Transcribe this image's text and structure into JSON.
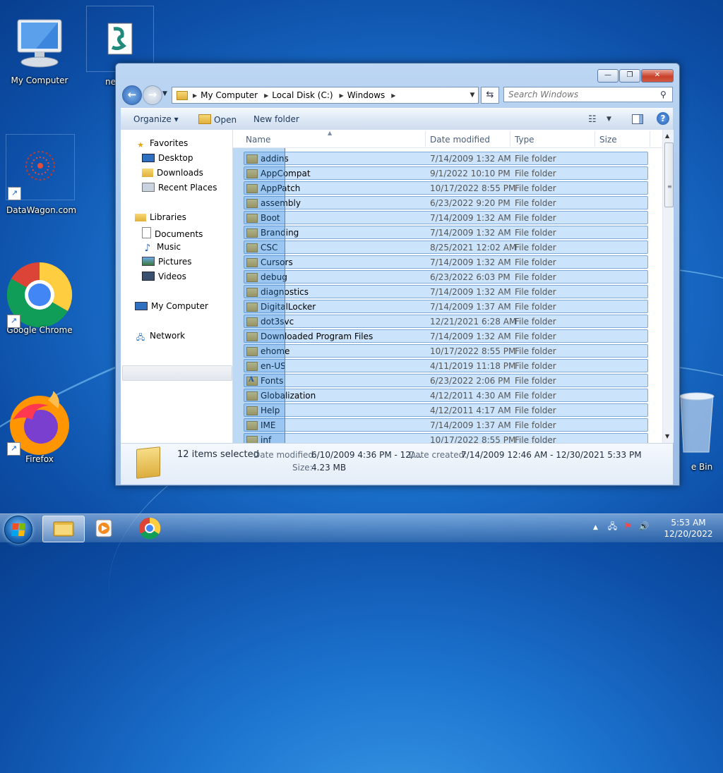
{
  "desktop": {
    "icons": [
      {
        "label": "My Computer"
      },
      {
        "label": "ne"
      },
      {
        "label": "DataWagon.com"
      },
      {
        "label": "Google Chrome"
      },
      {
        "label": "Firefox"
      },
      {
        "label": "e Bin"
      }
    ]
  },
  "window": {
    "caption_buttons": {
      "minimize": "—",
      "maximize": "❐",
      "close": "✕"
    },
    "address": {
      "segments": [
        "My Computer",
        "Local Disk (C:)",
        "Windows"
      ]
    },
    "search_placeholder": "Search Windows",
    "toolbar": {
      "organize": "Organize",
      "open": "Open",
      "new_folder": "New folder"
    },
    "nav": {
      "favorites": "Favorites",
      "desktop": "Desktop",
      "downloads": "Downloads",
      "recent_places": "Recent Places",
      "libraries": "Libraries",
      "documents": "Documents",
      "music": "Music",
      "pictures": "Pictures",
      "videos": "Videos",
      "my_computer": "My Computer",
      "network": "Network"
    },
    "columns": {
      "name": "Name",
      "date": "Date modified",
      "type": "Type",
      "size": "Size"
    },
    "files": [
      {
        "name": "addins",
        "date": "7/14/2009 1:32 AM",
        "type": "File folder"
      },
      {
        "name": "AppCompat",
        "date": "9/1/2022 10:10 PM",
        "type": "File folder"
      },
      {
        "name": "AppPatch",
        "date": "10/17/2022 8:55 PM",
        "type": "File folder"
      },
      {
        "name": "assembly",
        "date": "6/23/2022 9:20 PM",
        "type": "File folder"
      },
      {
        "name": "Boot",
        "date": "7/14/2009 1:32 AM",
        "type": "File folder"
      },
      {
        "name": "Branding",
        "date": "7/14/2009 1:32 AM",
        "type": "File folder"
      },
      {
        "name": "CSC",
        "date": "8/25/2021 12:02 AM",
        "type": "File folder"
      },
      {
        "name": "Cursors",
        "date": "7/14/2009 1:32 AM",
        "type": "File folder"
      },
      {
        "name": "debug",
        "date": "6/23/2022 6:03 PM",
        "type": "File folder"
      },
      {
        "name": "diagnostics",
        "date": "7/14/2009 1:32 AM",
        "type": "File folder"
      },
      {
        "name": "DigitalLocker",
        "date": "7/14/2009 1:37 AM",
        "type": "File folder"
      },
      {
        "name": "dot3svc",
        "date": "12/21/2021 6:28 AM",
        "type": "File folder"
      },
      {
        "name": "Downloaded Program Files",
        "date": "7/14/2009 1:32 AM",
        "type": "File folder"
      },
      {
        "name": "ehome",
        "date": "10/17/2022 8:55 PM",
        "type": "File folder"
      },
      {
        "name": "en-US",
        "date": "4/11/2019 11:18 PM",
        "type": "File folder"
      },
      {
        "name": "Fonts",
        "date": "6/23/2022 2:06 PM",
        "type": "File folder"
      },
      {
        "name": "Globalization",
        "date": "4/12/2011 4:30 AM",
        "type": "File folder"
      },
      {
        "name": "Help",
        "date": "4/12/2011 4:17 AM",
        "type": "File folder"
      },
      {
        "name": "IME",
        "date": "7/14/2009 1:37 AM",
        "type": "File folder"
      },
      {
        "name": "inf",
        "date": "10/17/2022 8:55 PM",
        "type": "File folder"
      }
    ],
    "details": {
      "selected": "12 items selected",
      "date_modified_label": "Date modified:",
      "date_modified_value": "6/10/2009 4:36 PM - 12/...",
      "date_created_label": "Date created:",
      "date_created_value": "7/14/2009 12:46 AM - 12/30/2021 5:33 PM",
      "size_label": "Size:",
      "size_value": "4.23 MB"
    }
  },
  "taskbar": {
    "clock_time": "5:53 AM",
    "clock_date": "12/20/2022"
  }
}
